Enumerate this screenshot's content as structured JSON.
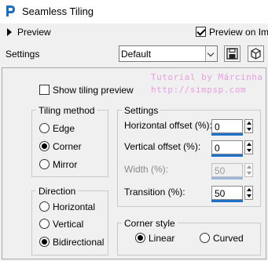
{
  "window": {
    "title": "Seamless Tiling"
  },
  "preview": {
    "label": "Preview",
    "preview_on_image_label": "Preview on Ima",
    "preview_on_image_checked": true
  },
  "settings_row": {
    "label": "Settings",
    "preset_value": "Default"
  },
  "show_tiling": {
    "label": "Show tiling preview",
    "checked": false
  },
  "watermark": {
    "line1": "Tutorial by Márcinha",
    "line2": "http://simpsp.com"
  },
  "tiling_method": {
    "title": "Tiling method",
    "options": [
      {
        "label": "Edge",
        "selected": false
      },
      {
        "label": "Corner",
        "selected": true
      },
      {
        "label": "Mirror",
        "selected": false
      }
    ]
  },
  "direction": {
    "title": "Direction",
    "options": [
      {
        "label": "Horizontal",
        "selected": false
      },
      {
        "label": "Vertical",
        "selected": false
      },
      {
        "label": "Bidirectional",
        "selected": true
      }
    ]
  },
  "settings_group": {
    "title": "Settings",
    "fields": [
      {
        "label": "Horizontal offset (%):",
        "value": "0",
        "enabled": true
      },
      {
        "label": "Vertical offset (%):",
        "value": "0",
        "enabled": true
      },
      {
        "label": "Width (%):",
        "value": "50",
        "enabled": false
      },
      {
        "label": "Transition (%):",
        "value": "50",
        "enabled": true
      }
    ]
  },
  "corner_style": {
    "title": "Corner style",
    "options": [
      {
        "label": "Linear",
        "selected": true
      },
      {
        "label": "Curved",
        "selected": false
      }
    ]
  },
  "icons": {
    "app": "psp-logo-icon",
    "expand": "triangle-right-icon",
    "save": "floppy-disk-icon",
    "reset": "cube-icon"
  },
  "colors": {
    "accent_bar": "#1e70c8",
    "watermark": "#e79ee0"
  }
}
